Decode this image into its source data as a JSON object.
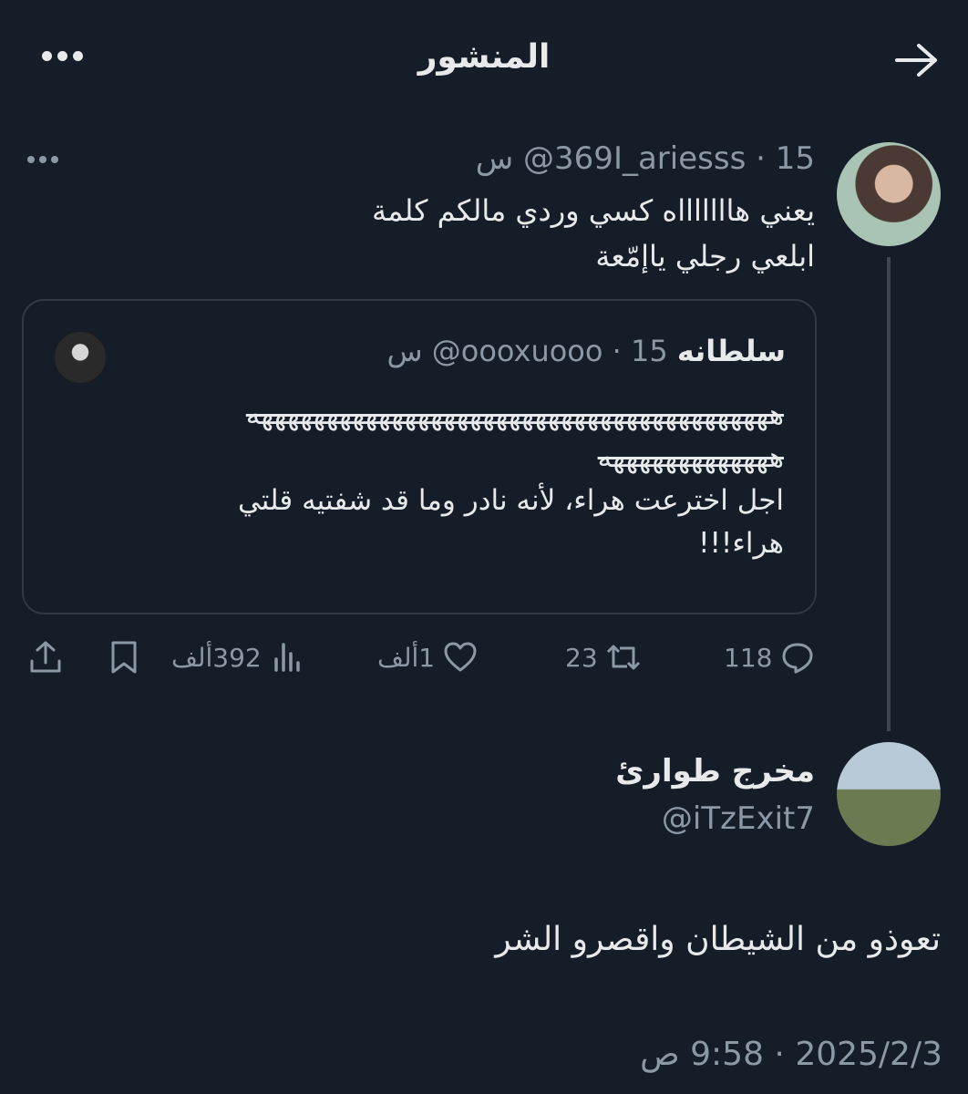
{
  "header": {
    "title": "المنشور"
  },
  "main_tweet": {
    "handle": "@369I_ariesss",
    "time": "15 س",
    "line1": "يعني هاااااااه كسي وردي مالكم كلمة",
    "line2": "ابلعي رجلي ياإمّعة"
  },
  "quote": {
    "name": "سلطانه",
    "handle": "@oooxuooo",
    "time": "15 س",
    "strike1": "ههههههههههههههههههههههههههههههههههههههههه",
    "strike2": "هههههههههههههه",
    "line3": "اجل اخترعت هراء، لأنه نادر وما قد شفتيه قلتي",
    "line4": "هراء!!!"
  },
  "actions": {
    "replies": "118",
    "retweets": "23",
    "likes": "1ألف",
    "views": "392ألف"
  },
  "reply": {
    "name": "مخرج طوارئ",
    "handle": "@iTzExit7",
    "text": "تعوذو من الشيطان واقصرو الشر",
    "timestamp": "2025/2/3 · 9:58 ص"
  },
  "colors": {
    "background": "#151d28",
    "text": "#e7e9ea",
    "muted": "#8b98a5",
    "border": "#2f3a46"
  }
}
